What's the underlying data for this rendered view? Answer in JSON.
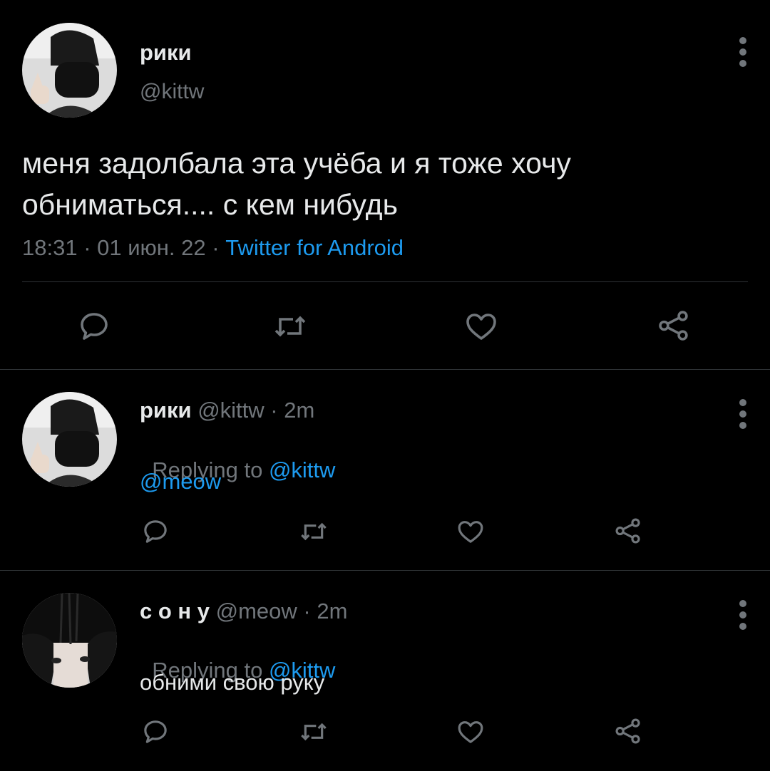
{
  "main_tweet": {
    "author_name": "рики",
    "author_handle": "@kittw",
    "text_line1": "меня задолбала эта учёба и я тоже хочу",
    "text_line2": "обниматься.... с кем нибудь",
    "time": "18:31",
    "sep1": " · ",
    "date": "01 июн. 22",
    "sep2": " · ",
    "source": "Twitter for Android"
  },
  "replies": [
    {
      "author_name": "рики",
      "author_handle": "@kittw",
      "age": " · 2m",
      "replying_label": "Replying to ",
      "replying_handle": "@kittw",
      "text": "@meow"
    },
    {
      "author_name": "с о н у",
      "author_handle": "@meow",
      "age": " · 2m",
      "replying_label": "Replying to ",
      "replying_handle": "@kittw",
      "text": "обними свою руку"
    }
  ],
  "icons": [
    "comment-icon",
    "retweet-icon",
    "like-icon",
    "share-icon",
    "more-options-icon"
  ],
  "colors": {
    "background": "#000000",
    "text": "#e7e9ea",
    "muted": "#71767b",
    "link": "#1d9bf0",
    "divider": "#2f3336"
  }
}
